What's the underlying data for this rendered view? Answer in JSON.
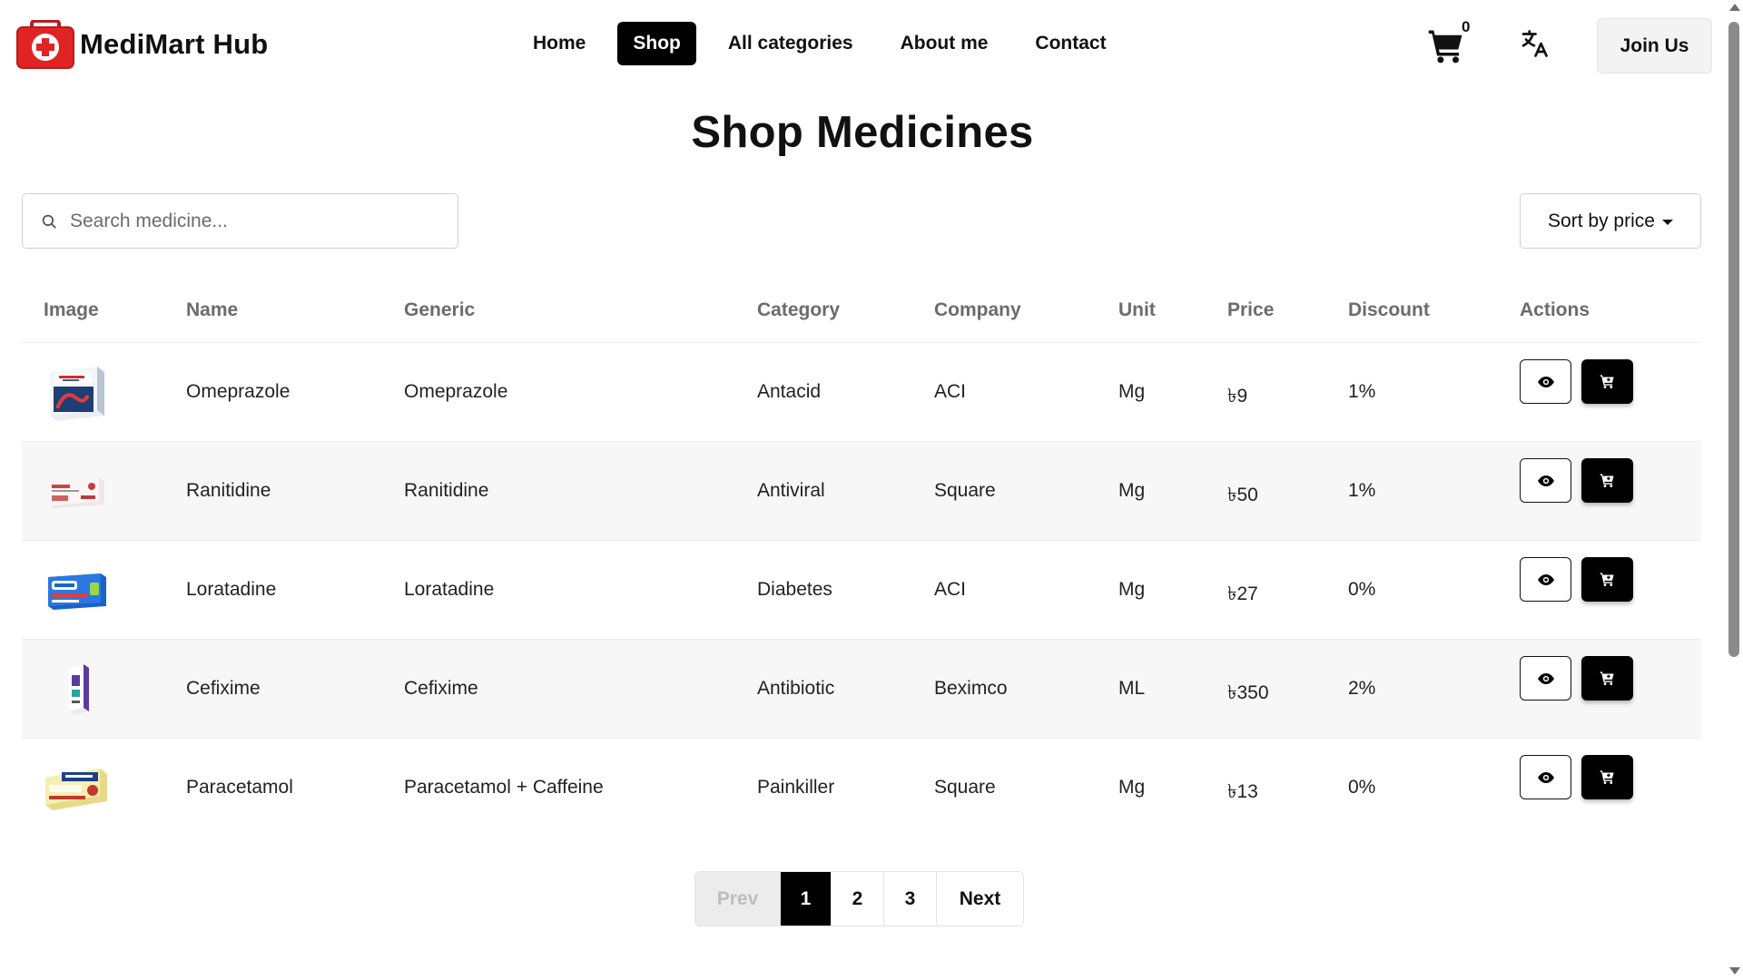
{
  "brand": {
    "name": "MediMart Hub",
    "icon": "first-aid-kit-icon",
    "icon_color": "#e02424"
  },
  "nav": {
    "links": [
      {
        "label": "Home",
        "active": false
      },
      {
        "label": "Shop",
        "active": true
      },
      {
        "label": "All categories",
        "active": false
      },
      {
        "label": "About me",
        "active": false
      },
      {
        "label": "Contact",
        "active": false
      }
    ],
    "cart_count": "0",
    "cart_icon": "shopping-cart-icon",
    "translate_icon": "translate-icon",
    "join_label": "Join Us"
  },
  "page": {
    "title": "Shop Medicines"
  },
  "toolbar": {
    "search_placeholder": "Search medicine...",
    "search_value": "",
    "sort_label": "Sort by price"
  },
  "table": {
    "headers": [
      "Image",
      "Name",
      "Generic",
      "Category",
      "Company",
      "Unit",
      "Price",
      "Discount",
      "Actions"
    ],
    "rows": [
      {
        "image": "omeprazole-box",
        "name": "Omeprazole",
        "generic": "Omeprazole",
        "category": "Antacid",
        "company": "ACI",
        "unit": "Mg",
        "price": "৳9",
        "discount": "1%"
      },
      {
        "image": "ranitidine-box",
        "name": "Ranitidine",
        "generic": "Ranitidine",
        "category": "Antiviral",
        "company": "Square",
        "unit": "Mg",
        "price": "৳50",
        "discount": "1%"
      },
      {
        "image": "loratadine-box",
        "name": "Loratadine",
        "generic": "Loratadine",
        "category": "Diabetes",
        "company": "ACI",
        "unit": "Mg",
        "price": "৳27",
        "discount": "0%"
      },
      {
        "image": "cefixime-box",
        "name": "Cefixime",
        "generic": "Cefixime",
        "category": "Antibiotic",
        "company": "Beximco",
        "unit": "ML",
        "price": "৳350",
        "discount": "2%"
      },
      {
        "image": "paracetamol-box",
        "name": "Paracetamol",
        "generic": "Paracetamol + Caffeine",
        "category": "Painkiller",
        "company": "Square",
        "unit": "Mg",
        "price": "৳13",
        "discount": "0%"
      }
    ],
    "action_icons": {
      "view": "eye-icon",
      "cart": "add-to-cart-icon"
    }
  },
  "pagination": {
    "prev_label": "Prev",
    "pages": [
      "1",
      "2",
      "3"
    ],
    "current": "1",
    "next_label": "Next"
  },
  "colors": {
    "accent": "#000000",
    "muted_header": "#6b6b6b",
    "alt_row": "#f7f7f7"
  }
}
